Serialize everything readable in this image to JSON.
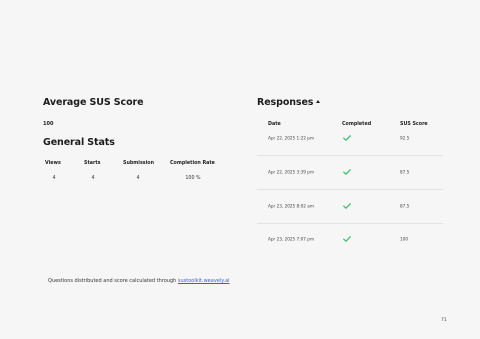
{
  "avg_sus": {
    "title": "Average SUS Score",
    "value": "100"
  },
  "general_stats": {
    "title": "General Stats",
    "headers": [
      "Views",
      "Starts",
      "Submission",
      "Completion Rate"
    ],
    "values": [
      "4",
      "4",
      "4",
      "100 %"
    ]
  },
  "responses": {
    "title": "Responses",
    "sort_icon": "sort-up-arrow",
    "headers": [
      "Date",
      "Completed",
      "SUS Score"
    ],
    "rows": [
      {
        "date": "Apr 22, 2025 1:22 pm",
        "completed_icon": "check-icon",
        "score": "92.5"
      },
      {
        "date": "Apr 22, 2025 3:39 pm",
        "completed_icon": "check-icon",
        "score": "87.5"
      },
      {
        "date": "Apr 23, 2025 8:02 am",
        "completed_icon": "check-icon",
        "score": "87.5"
      },
      {
        "date": "Apr 23, 2025 7:07 pm",
        "completed_icon": "check-icon",
        "score": "100"
      }
    ]
  },
  "footer": {
    "text": "Questions distributed and score calculated through ",
    "link": "sustoolkit.weavely.ai"
  },
  "page_number": "71",
  "colors": {
    "background": "#f6f6f6",
    "check": "#3cc06b",
    "link": "#3b5bdb"
  }
}
